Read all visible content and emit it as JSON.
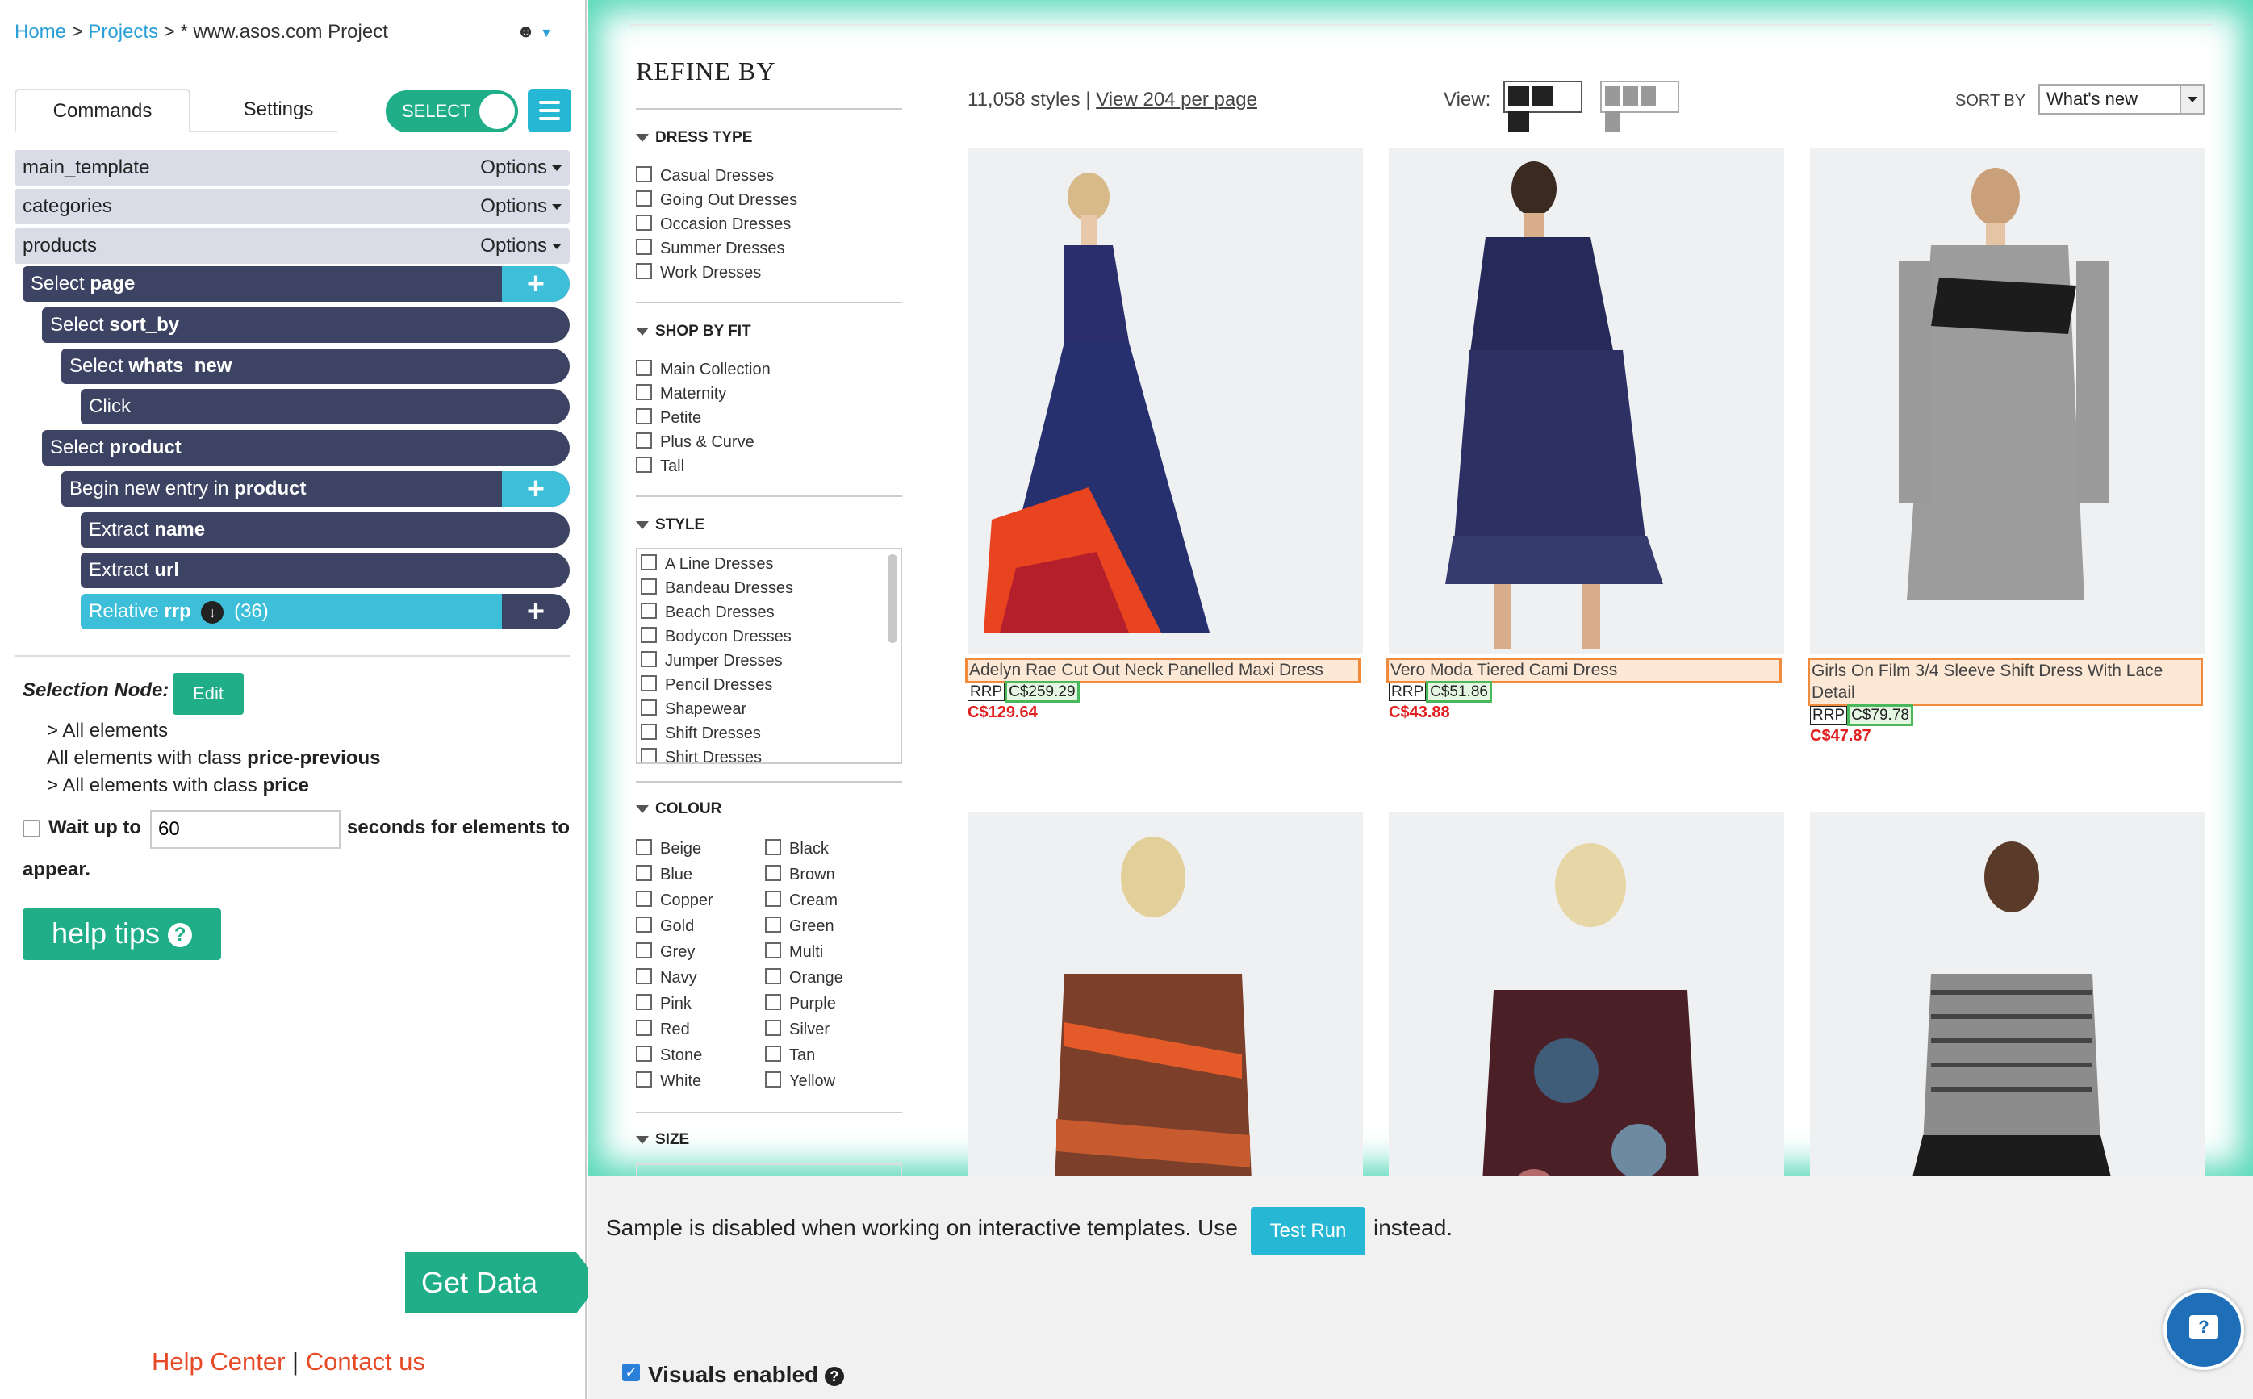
{
  "breadcrumb": {
    "home": "Home",
    "sep1": ">",
    "projects": "Projects",
    "sep2": ">",
    "current": "* www.asos.com Project"
  },
  "tabs": {
    "commands": "Commands",
    "settings": "Settings"
  },
  "toggle": {
    "label": "SELECT",
    "state": "on"
  },
  "templates": [
    {
      "name": "main_template",
      "options": "Options"
    },
    {
      "name": "categories",
      "options": "Options"
    },
    {
      "name": "products",
      "options": "Options"
    }
  ],
  "commands": [
    {
      "verb": "Select",
      "target": "page"
    },
    {
      "verb": "Select",
      "target": "sort_by"
    },
    {
      "verb": "Select",
      "target": "whats_new"
    },
    {
      "verb": "Click",
      "target": ""
    },
    {
      "verb": "Select",
      "target": "product"
    },
    {
      "verb": "Begin new entry in",
      "target": "product"
    },
    {
      "verb": "Extract",
      "target": "name"
    },
    {
      "verb": "Extract",
      "target": "url"
    },
    {
      "verb": "Relative",
      "target": "rrp",
      "count": "(36)"
    }
  ],
  "selection": {
    "label": "Selection Node:",
    "edit": "Edit",
    "line1": "> All elements",
    "line2_prefix": "All elements with class ",
    "line2_class": "price-previous",
    "line3_prefix": "> All elements with class ",
    "line3_class": "price"
  },
  "wait": {
    "label": "Wait up to",
    "value": "60",
    "suffix": "seconds for elements to",
    "suffix2": "appear."
  },
  "help_tips": "help tips",
  "get_data": "Get Data",
  "footer": {
    "help": "Help Center",
    "sep": "|",
    "contact": "Contact us"
  },
  "refine": {
    "title": "REFINE BY",
    "dress_type": {
      "heading": "DRESS TYPE",
      "items": [
        "Casual Dresses",
        "Going Out Dresses",
        "Occasion Dresses",
        "Summer Dresses",
        "Work Dresses"
      ]
    },
    "shop_by_fit": {
      "heading": "SHOP BY FIT",
      "items": [
        "Main Collection",
        "Maternity",
        "Petite",
        "Plus & Curve",
        "Tall"
      ]
    },
    "style": {
      "heading": "STYLE",
      "items": [
        "A Line Dresses",
        "Bandeau Dresses",
        "Beach Dresses",
        "Bodycon Dresses",
        "Jumper Dresses",
        "Pencil Dresses",
        "Shapewear",
        "Shift Dresses",
        "Shirt Dresses"
      ]
    },
    "colour": {
      "heading": "COLOUR",
      "col1": [
        "Beige",
        "Blue",
        "Copper",
        "Gold",
        "Grey",
        "Navy",
        "Pink",
        "Red",
        "Stone",
        "White"
      ],
      "col2": [
        "Black",
        "Brown",
        "Cream",
        "Green",
        "Multi",
        "Orange",
        "Purple",
        "Silver",
        "Tan",
        "Yellow"
      ]
    },
    "size": {
      "heading": "SIZE"
    }
  },
  "listing": {
    "count": "11,058 styles",
    "sep": "|",
    "per_page": "View 204 per page",
    "view_label": "View:",
    "sort_label": "SORT BY",
    "sort_value": "What's new"
  },
  "products": [
    {
      "name": "Adelyn Rae Cut Out Neck Panelled Maxi Dress",
      "rrp_label": "RRP",
      "rrp": "C$259.29",
      "price": "C$129.64"
    },
    {
      "name": "Vero Moda Tiered Cami Dress",
      "rrp_label": "RRP",
      "rrp": "C$51.86",
      "price": "C$43.88"
    },
    {
      "name": "Girls On Film 3/4 Sleeve Shift Dress With Lace Detail",
      "rrp_label": "RRP",
      "rrp": "C$79.78",
      "price": "C$47.87"
    }
  ],
  "bottom": {
    "msg": "Sample is disabled when working on interactive templates. Use",
    "test_run": "Test Run",
    "msg2": "instead.",
    "visuals": "Visuals enabled"
  },
  "colors": {
    "teal": "#1fae87",
    "cyan": "#25b7d3",
    "navy_cmd": "#3d4463",
    "link_blue": "#2a9fd8",
    "price_red": "#e02020",
    "glow": "#57d8b8"
  }
}
